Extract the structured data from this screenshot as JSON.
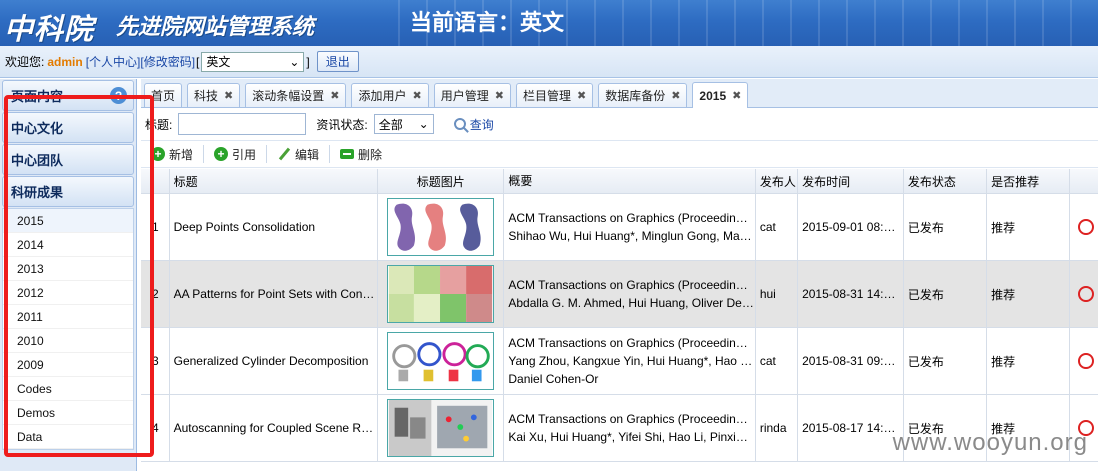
{
  "header": {
    "logo": "中科院",
    "system_title": "先进院网站管理系统",
    "current_language": "当前语言：英文"
  },
  "userbar": {
    "welcome": "欢迎您:",
    "username": "admin",
    "personal_center": "[个人中心]",
    "change_password": "[修改密码]",
    "bracket_open": "[",
    "bracket_close": "]",
    "language_value": "英文",
    "logout": "退出"
  },
  "sidebar": {
    "sections": [
      "页面内容",
      "中心文化",
      "中心团队",
      "科研成果"
    ],
    "help": "?",
    "sub_items": [
      "2015",
      "2014",
      "2013",
      "2012",
      "2011",
      "2010",
      "2009",
      "Codes",
      "Demos",
      "Data"
    ]
  },
  "tabs": [
    {
      "label": "首页",
      "closable": false
    },
    {
      "label": "科技",
      "closable": true
    },
    {
      "label": "滚动条幅设置",
      "closable": true
    },
    {
      "label": "添加用户",
      "closable": true
    },
    {
      "label": "用户管理",
      "closable": true
    },
    {
      "label": "栏目管理",
      "closable": true
    },
    {
      "label": "数据库备份",
      "closable": true
    },
    {
      "label": "2015",
      "closable": true,
      "active": true
    }
  ],
  "tab_close_glyph": "✖",
  "filter": {
    "title_label": "标题:",
    "status_label": "资讯状态:",
    "status_value": "全部",
    "query": "查询"
  },
  "toolbar": {
    "add": "新增",
    "cite": "引用",
    "edit": "编辑",
    "delete": "删除"
  },
  "table": {
    "headers": {
      "title": "标题",
      "image": "标题图片",
      "summary": "概要",
      "publisher": "发布人",
      "time": "发布时间",
      "status": "发布状态",
      "recommend": "是否推荐"
    },
    "rows": [
      {
        "num": "1",
        "title": "Deep Points Consolidation",
        "summary": [
          "ACM Transactions on Graphics (Proceedin…",
          "Shihao Wu, Hui Huang*, Minglun Gong, Ma…"
        ],
        "publisher": "cat",
        "time": "2015-09-01 08:…",
        "status": "已发布",
        "recommend": "推荐"
      },
      {
        "num": "2",
        "title": "AA Patterns for Point Sets with Con…",
        "summary": [
          "ACM Transactions on Graphics (Proceedin…",
          "Abdalla G. M. Ahmed, Hui Huang, Oliver De…"
        ],
        "publisher": "hui",
        "time": "2015-08-31 14:…",
        "status": "已发布",
        "recommend": "推荐"
      },
      {
        "num": "3",
        "title": "Generalized Cylinder Decomposition",
        "summary": [
          "ACM Transactions on Graphics (Proceedin…",
          "Yang Zhou, Kangxue Yin, Hui Huang*, Hao …",
          "Daniel Cohen-Or"
        ],
        "publisher": "cat",
        "time": "2015-08-31 09:…",
        "status": "已发布",
        "recommend": "推荐"
      },
      {
        "num": "4",
        "title": "Autoscanning for Coupled Scene R…",
        "summary": [
          "ACM Transactions on Graphics (Proceedin…",
          "Kai Xu, Hui Huang*, Yifei Shi, Hao Li, Pinxi…"
        ],
        "publisher": "rinda",
        "time": "2015-08-17 14:…",
        "status": "已发布",
        "recommend": "推荐"
      }
    ]
  },
  "watermark": "www.wooyun.org",
  "colors": {
    "header_blue": "#2e6cc2",
    "highlight_red": "#ee1c1c",
    "username_orange": "#e37b00"
  }
}
